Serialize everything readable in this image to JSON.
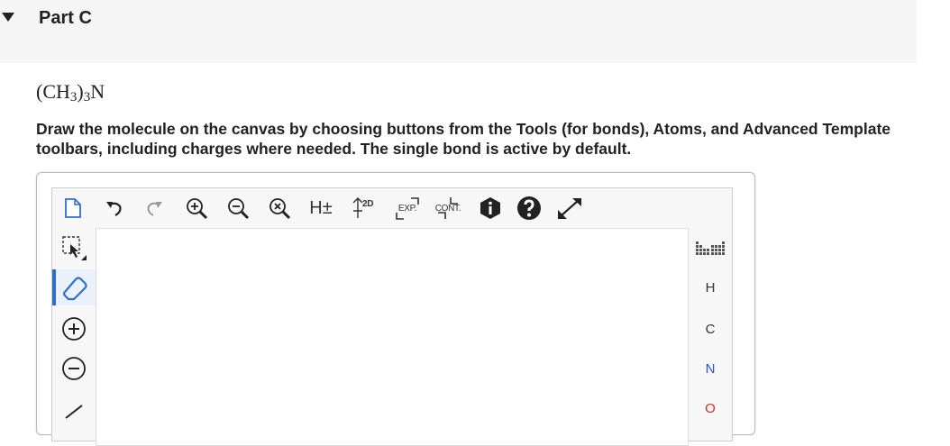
{
  "part": {
    "title": "Part C"
  },
  "question": {
    "formula_parts": [
      "(CH",
      "3",
      ")",
      "3",
      "N"
    ],
    "instructions": "Draw the molecule on the canvas by choosing buttons from the Tools (for bonds), Atoms, and Advanced Template toolbars, including charges where needed. The single bond is active by default."
  },
  "toolbar": {
    "items": [
      {
        "icon": "new-document-icon"
      },
      {
        "icon": "undo-icon"
      },
      {
        "icon": "redo-icon"
      },
      {
        "icon": "zoom-in-icon"
      },
      {
        "icon": "zoom-out-icon"
      },
      {
        "icon": "clear-icon"
      },
      {
        "icon": "hydrogen-toggle-icon",
        "label": "H±"
      },
      {
        "icon": "clean-2d-icon",
        "label": "2D"
      },
      {
        "icon": "expand-icon",
        "label": "EXP."
      },
      {
        "icon": "contract-icon",
        "label": "CONT."
      },
      {
        "icon": "info-icon"
      },
      {
        "icon": "help-icon"
      },
      {
        "icon": "fullscreen-icon"
      }
    ]
  },
  "left_tools": [
    {
      "icon": "selection-icon"
    },
    {
      "icon": "eraser-icon",
      "active": true
    },
    {
      "icon": "positive-charge-icon"
    },
    {
      "icon": "negative-charge-icon"
    },
    {
      "icon": "single-bond-icon"
    }
  ],
  "atoms": [
    "H",
    "C",
    "N",
    "O"
  ],
  "colors": {
    "accent": "#2f6fca",
    "nitrogen": "#2c4fd6",
    "oxygen": "#e02a1e"
  }
}
